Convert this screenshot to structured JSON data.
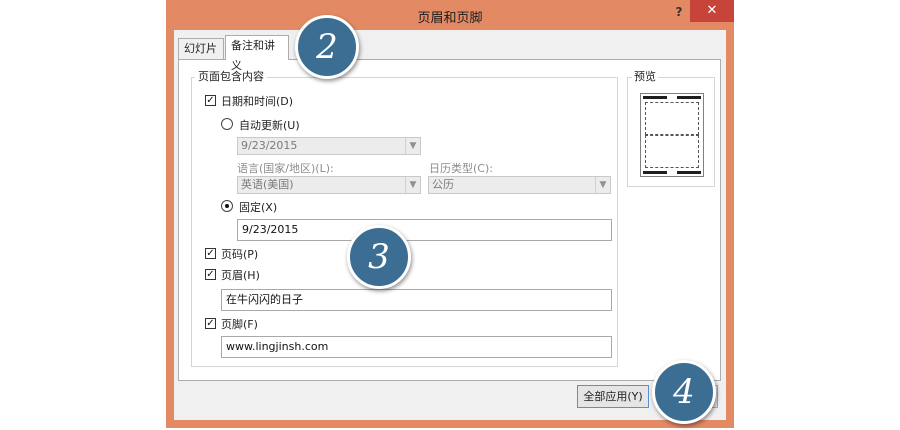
{
  "window": {
    "title": "页眉和页脚",
    "help_label": "?",
    "close_label": "✕",
    "colors": {
      "frame": "#e38a65",
      "close": "#c7443a",
      "badge": "#3c6e93"
    }
  },
  "tabs": [
    {
      "label": "幻灯片"
    },
    {
      "label": "备注和讲义"
    }
  ],
  "page_contains": {
    "legend": "页面包含内容",
    "date_time": {
      "label": "日期和时间(D)",
      "checked": true
    },
    "auto_update": {
      "label": "自动更新(U)",
      "selected": false,
      "value": "9/23/2015"
    },
    "language": {
      "label": "语言(国家/地区)(L):",
      "value": "英语(美国)"
    },
    "calendar": {
      "label": "日历类型(C):",
      "value": "公历"
    },
    "fixed": {
      "label": "固定(X)",
      "selected": true,
      "value": "9/23/2015"
    },
    "page_number": {
      "label": "页码(P)",
      "checked": true
    },
    "header": {
      "label": "页眉(H)",
      "checked": true,
      "value": "在牛闪闪的日子"
    },
    "footer": {
      "label": "页脚(F)",
      "checked": true,
      "value": "www.lingjinsh.com"
    }
  },
  "preview": {
    "legend": "预览"
  },
  "buttons": {
    "apply_all": "全部应用(Y)"
  },
  "icons": {
    "checkbox": "checkmark-icon",
    "dropdown": "chevron-down-icon",
    "close": "close-icon",
    "help": "help-icon"
  },
  "badges": [
    "2",
    "3",
    "4"
  ]
}
